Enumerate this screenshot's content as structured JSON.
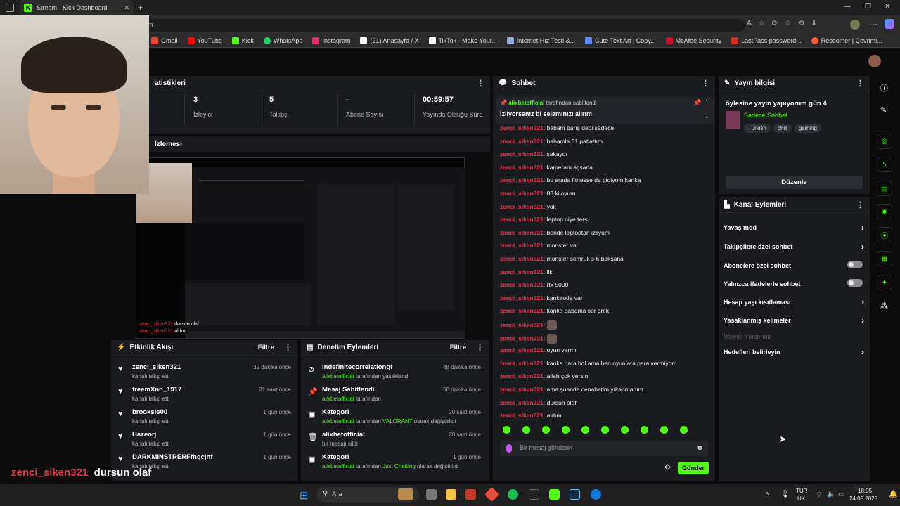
{
  "browser": {
    "tab_title": "Stream - Kick Dashboard",
    "url": "m",
    "bookmarks": [
      {
        "label": "Gmail",
        "color": "#ea4335"
      },
      {
        "label": "YouTube",
        "color": "#ff0000"
      },
      {
        "label": "Kick",
        "color": "#53fc18"
      },
      {
        "label": "WhatsApp",
        "color": "#25d366"
      },
      {
        "label": "Instagram",
        "color": "#e1306c"
      },
      {
        "label": "(21) Anasayfa / X",
        "color": "#ffffff"
      },
      {
        "label": "TikTok - Make Your...",
        "color": "#ffffff"
      },
      {
        "label": "İnternet Hız Testi &...",
        "color": "#9ad"
      },
      {
        "label": "Cute Text Art | Copy...",
        "color": "#5b8cff"
      },
      {
        "label": "McAfee Security",
        "color": "#c8102e"
      },
      {
        "label": "LastPass password...",
        "color": "#d32d27"
      },
      {
        "label": "Resoomer | Çevrimi...",
        "color": "#ff5a3c"
      }
    ]
  },
  "stats": {
    "title": "atistikleri",
    "items": [
      {
        "value": "3",
        "label": "İzleyici"
      },
      {
        "value": "5",
        "label": "Takipçi"
      },
      {
        "value": "-",
        "label": "Abone Sayısı"
      },
      {
        "value": "00:59:57",
        "label": "Yayında Olduğu Süre"
      }
    ]
  },
  "preview": {
    "title": "İzlemesi"
  },
  "activity": {
    "title": "Etkinlik Akışı",
    "filter": "Filtre",
    "items": [
      {
        "user": "zenci_siken321",
        "action": "kanalı takip etti",
        "time": "39 dakika önce"
      },
      {
        "user": "freemXnn_1917",
        "action": "kanalı takip etti",
        "time": "21 saat önce"
      },
      {
        "user": "brooksie00",
        "action": "kanalı takip etti",
        "time": "1 gün önce"
      },
      {
        "user": "Hazeorj",
        "action": "kanalı takip etti",
        "time": "1 gün önce"
      },
      {
        "user": "DARKMINSTRERFfhgcjhf",
        "action": "kanalı takip etti",
        "time": "1 gün önce"
      }
    ]
  },
  "moderation": {
    "title": "Denetim Eylemleri",
    "filter": "Filtre",
    "items": [
      {
        "title": "indefinitecorrelationqt",
        "by": "alixbetofficial",
        "rest": " tarafından yasaklandı",
        "extra": "",
        "tail": "",
        "time": "48 dakika önce"
      },
      {
        "title": "Mesaj Sabitlendi",
        "by": "alixbetofficial",
        "rest": " tarafından",
        "extra": "",
        "tail": "",
        "time": "58 dakika önce"
      },
      {
        "title": "Kategori",
        "by": "alixbetofficial",
        "rest": " tarafından ",
        "extra": "VALORANT",
        "tail": " olarak değiştirildi",
        "time": "20 saat önce"
      },
      {
        "title": "alixbetofficial",
        "by": "",
        "rest": "bir mesajı sildi",
        "extra": "",
        "tail": "",
        "time": "20 saat önce"
      },
      {
        "title": "Kategori",
        "by": "alixbetofficial",
        "rest": " tarafından ",
        "extra": "Just Chatting",
        "tail": " olarak değiştirildi",
        "time": "1 gün önce"
      }
    ]
  },
  "chat": {
    "title": "Sohbet",
    "pinned_by_user": "alixbetofficial",
    "pinned_by_text": "tarafından sabitlendi",
    "pinned_message": "İzliyorsanız bi selamınızı alırım",
    "username": "zenci_siken321",
    "messages": [
      "babam barış dedi sadece",
      "babamla 31 patlattım",
      "şakaydı",
      "kameranı açsana",
      "bu arada fitnesse da gidiyom kanka",
      "83 kiloyum",
      "yok",
      "leptop niye ters",
      "bende leptoptan izliyom",
      "monster var",
      "monster semruk s 6 baksana",
      "llkl",
      "rtx 5090",
      "kankaoda var",
      "kanka babama sor amk",
      "",
      "",
      "oyun varmı",
      "kanka para bol ama ben oyunlara para vermiyom",
      "allah çok versin",
      "ama şuanda cenabetim yıkanmadım",
      "dursun olaf",
      "aldım"
    ],
    "input_placeholder": "Bir mesaj gönderin",
    "send_label": "Gönder"
  },
  "streaminfo": {
    "title": "Yayın bilgisi",
    "stream_title": "öylesine yayın yapıyorum gün 4",
    "category": "Sadece Sohbet",
    "tags": [
      "Turkish",
      "chill",
      "gaming"
    ],
    "edit_label": "Düzenle"
  },
  "actions": {
    "title": "Kanal Eylemleri",
    "items": [
      {
        "label": "Yavaş mod",
        "type": "chevron"
      },
      {
        "label": "Takipçilere özel sohbet",
        "type": "chevron"
      },
      {
        "label": "Abonelere özel sohbet",
        "type": "toggle"
      },
      {
        "label": "Yalnızca ifadelerle sohbet",
        "type": "toggle"
      },
      {
        "label": "Hesap yaşı kısıtlaması",
        "type": "chevron"
      },
      {
        "label": "Yasaklanmış kelimeler",
        "type": "chevron"
      },
      {
        "label": "İzleyici Yönlendir",
        "type": "disabled"
      },
      {
        "label": "Hedefleri belirleyin",
        "type": "chevron"
      }
    ]
  },
  "captions": [
    {
      "user": "zenci_siken321",
      "text": "dursun olaf"
    },
    {
      "user": "zenci_siken321",
      "text": "aldım"
    }
  ],
  "taskbar": {
    "search_placeholder": "Ara",
    "lang_top": "TUR",
    "lang_bottom": "UK",
    "time": "18:05",
    "date": "24.08.2025"
  },
  "colors": {
    "accent": "#53fc18",
    "chat_user": "#e1364f",
    "panel": "#191b1f"
  }
}
